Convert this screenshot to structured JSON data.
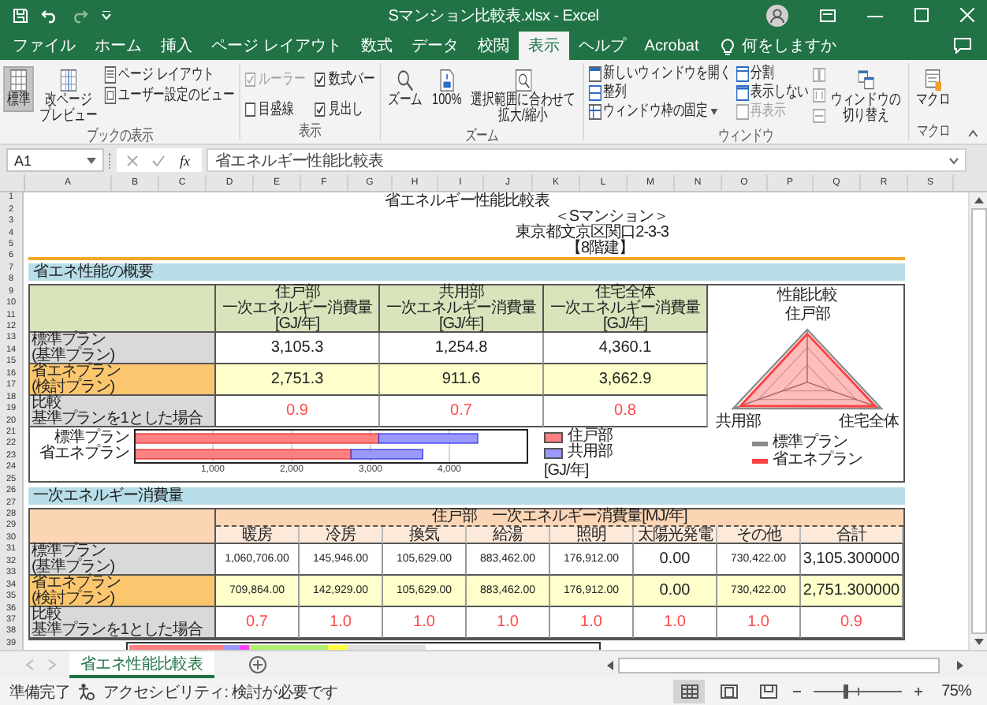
{
  "window": {
    "title": "Sマンション比較表.xlsx - Excel"
  },
  "tabs": [
    {
      "label": "ファイル",
      "selected": false
    },
    {
      "label": "ホーム",
      "selected": false
    },
    {
      "label": "挿入",
      "selected": false
    },
    {
      "label": "ページ レイアウト",
      "selected": false
    },
    {
      "label": "数式",
      "selected": false
    },
    {
      "label": "データ",
      "selected": false
    },
    {
      "label": "校閲",
      "selected": false
    },
    {
      "label": "表示",
      "selected": true
    },
    {
      "label": "ヘルプ",
      "selected": false
    },
    {
      "label": "Acrobat",
      "selected": false
    }
  ],
  "tell_me": {
    "placeholder": "何をしますか"
  },
  "ribbon": {
    "workbook_views": {
      "label": "ブックの表示",
      "normal": {
        "label": "標準",
        "selected": true
      },
      "page_break_preview": {
        "lines": [
          "改ページ",
          "プレビュー"
        ],
        "selected": false
      },
      "page_layout": {
        "label": "ページ レイアウト",
        "selected": false
      },
      "custom_views": "ユーザー設定のビュー"
    },
    "show": {
      "label": "表示",
      "options": [
        {
          "label": "ルーラー",
          "checked": true,
          "disabled": true
        },
        {
          "label": "数式バー",
          "checked": true,
          "disabled": false
        },
        {
          "label": "目盛線",
          "checked": false,
          "disabled": false
        },
        {
          "label": "見出し",
          "checked": true,
          "disabled": false
        }
      ]
    },
    "zoom": {
      "label": "ズーム",
      "zoom": "ズーム",
      "hundred": "100%",
      "zoom_to_selection": [
        "選択範囲に合わせて",
        "拡大/縮小"
      ]
    },
    "window": {
      "label": "ウィンドウ",
      "new_window": "新しいウィンドウを開く",
      "arrange_all": "整列",
      "freeze_panes": "ウィンドウ枠の固定",
      "split": {
        "label": "分割",
        "disabled": false
      },
      "hide": {
        "label": "表示しない",
        "disabled": false
      },
      "unhide": {
        "label": "再表示",
        "disabled": true
      },
      "switch_windows": [
        "ウィンドウの",
        "切り替え"
      ]
    },
    "macros": {
      "label": "マクロ",
      "macros": "マクロ"
    }
  },
  "formula_bar": {
    "name_box": "A1",
    "function_button": "fx",
    "content": "省エネルギー性能比較表"
  },
  "sheet": {
    "columns": [
      "A",
      "B",
      "C",
      "D",
      "E",
      "F",
      "G",
      "H",
      "I",
      "J",
      "K",
      "L",
      "M",
      "N",
      "O",
      "P",
      "Q",
      "R",
      "S"
    ],
    "row_numbers": [
      "1",
      "2",
      "3",
      "4",
      "5",
      "6",
      "7",
      "8",
      "9",
      "10",
      "11",
      "12",
      "13",
      "14",
      "15",
      "16",
      "17",
      "18",
      "19",
      "20",
      "21",
      "22",
      "23",
      "24",
      "25",
      "26",
      "27",
      "28",
      "29",
      "30",
      "31",
      "32",
      "33",
      "34",
      "35",
      "36",
      "37",
      "38",
      "39"
    ],
    "title": "省エネルギー性能比較表",
    "building": {
      "name": "＜Sマンション＞",
      "address": "東京都文京区関口2-3-3",
      "floors": "【8階建】"
    },
    "summary": {
      "heading": "省エネ性能の概要",
      "columns": [
        [
          "住戸部",
          "一次エネルギー消費量",
          "[GJ/年]"
        ],
        [
          "共用部",
          "一次エネルギー消費量",
          "[GJ/年]"
        ],
        [
          "住宅全体",
          "一次エネルギー消費量",
          "[GJ/年]"
        ]
      ],
      "rows": [
        {
          "kind": "base",
          "label": "標準プラン",
          "note": "(基準プラン)",
          "values": [
            "3,105.3",
            "1,254.8",
            "4,360.1"
          ]
        },
        {
          "kind": "proposed",
          "label": "省エネプラン",
          "note": "(検討プラン)",
          "values": [
            "2,751.3",
            "911.6",
            "3,662.9"
          ]
        },
        {
          "kind": "ratio",
          "label": "比較",
          "note": "基準プランを1とした場合",
          "values": [
            "0.9",
            "0.7",
            "0.8"
          ]
        }
      ],
      "chart_data": {
        "type": "bar",
        "orientation": "horizontal",
        "stacked": true,
        "categories": [
          "標準プラン",
          "省エネプラン"
        ],
        "xlabel": "[GJ/年]",
        "xlim": [
          0,
          5000
        ],
        "grid": true,
        "legend": "right",
        "xticks": [
          {
            "value": 1000,
            "label": "1,000"
          },
          {
            "value": 2000,
            "label": "2,000"
          },
          {
            "value": 3000,
            "label": "3,000"
          },
          {
            "value": 4000,
            "label": "4,000"
          }
        ],
        "series": [
          {
            "name": "住戸部",
            "color": "#ff8080",
            "values": [
              3105.3,
              2751.3
            ]
          },
          {
            "name": "共用部",
            "color": "#9999ff",
            "values": [
              1254.8,
              911.6
            ]
          }
        ]
      },
      "radar": {
        "title": "性能比較",
        "axes": [
          "住戸部",
          "共用部",
          "住宅全体"
        ],
        "legend": [
          {
            "label": "標準プラン",
            "color": "#8c8c8c"
          },
          {
            "label": "省エネプラン",
            "color": "#ff4040"
          }
        ]
      }
    },
    "consumption": {
      "heading": "一次エネルギー消費量",
      "title": "住戸部　一次エネルギー消費量[MJ/年]",
      "columns": [
        "暖房",
        "冷房",
        "換気",
        "給湯",
        "照明",
        "太陽光発電",
        "その他",
        "合計"
      ],
      "rows": [
        {
          "kind": "base",
          "label": "標準プラン",
          "note": "(基準プラン)",
          "values": [
            "1,060,706.00",
            "145,946.00",
            "105,629.00",
            "883,462.00",
            "176,912.00",
            "0.00",
            "730,422.00",
            "3,105.300000"
          ]
        },
        {
          "kind": "proposed",
          "label": "省エネプラン",
          "note": "(検討プラン)",
          "values": [
            "709,864.00",
            "142,929.00",
            "105,629.00",
            "883,462.00",
            "176,912.00",
            "0.00",
            "730,422.00",
            "2,751.300000"
          ]
        },
        {
          "kind": "ratio",
          "label": "比較",
          "note": "基準プランを1とした場合",
          "values": [
            "0.7",
            "1.0",
            "1.0",
            "1.0",
            "1.0",
            "1.0",
            "1.0",
            "0.9"
          ]
        }
      ]
    }
  },
  "sheet_tabs": [
    {
      "label": "省エネ性能比較表",
      "selected": true
    }
  ],
  "status_bar": {
    "status": "準備完了",
    "accessibility": "アクセシビリティ: 検討が必要です",
    "views": [
      {
        "kind": "normal",
        "selected": true
      },
      {
        "kind": "page_layout",
        "selected": false
      },
      {
        "kind": "page_break",
        "selected": false
      }
    ],
    "zoom": {
      "level": 0.36,
      "reading": "75%"
    }
  }
}
